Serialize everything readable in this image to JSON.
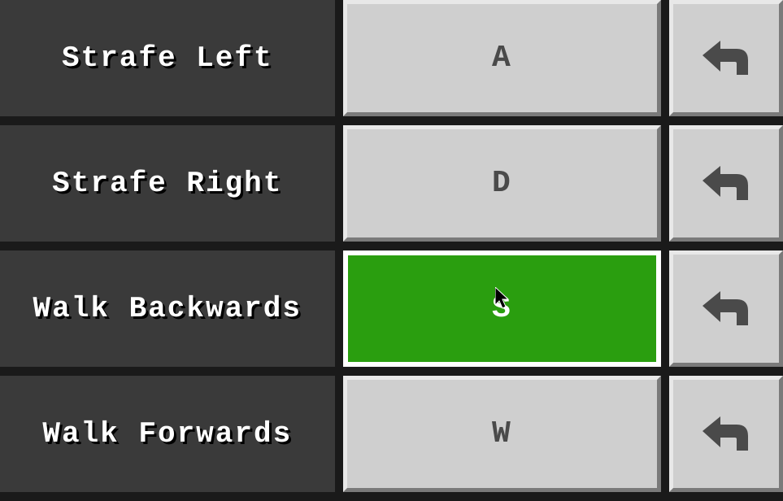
{
  "keybinds": [
    {
      "label": "Strafe Left",
      "key": "A",
      "active": false
    },
    {
      "label": "Strafe Right",
      "key": "D",
      "active": false
    },
    {
      "label": "Walk Backwards",
      "key": "S",
      "active": true
    },
    {
      "label": "Walk Forwards",
      "key": "W",
      "active": false
    }
  ],
  "colors": {
    "background": "#1a1a1a",
    "label_bg": "#3a3a3a",
    "button_bg": "#cfcfcf",
    "button_active_bg": "#2a9e0f",
    "text_white": "#ffffff",
    "text_dark": "#4a4a4a"
  }
}
